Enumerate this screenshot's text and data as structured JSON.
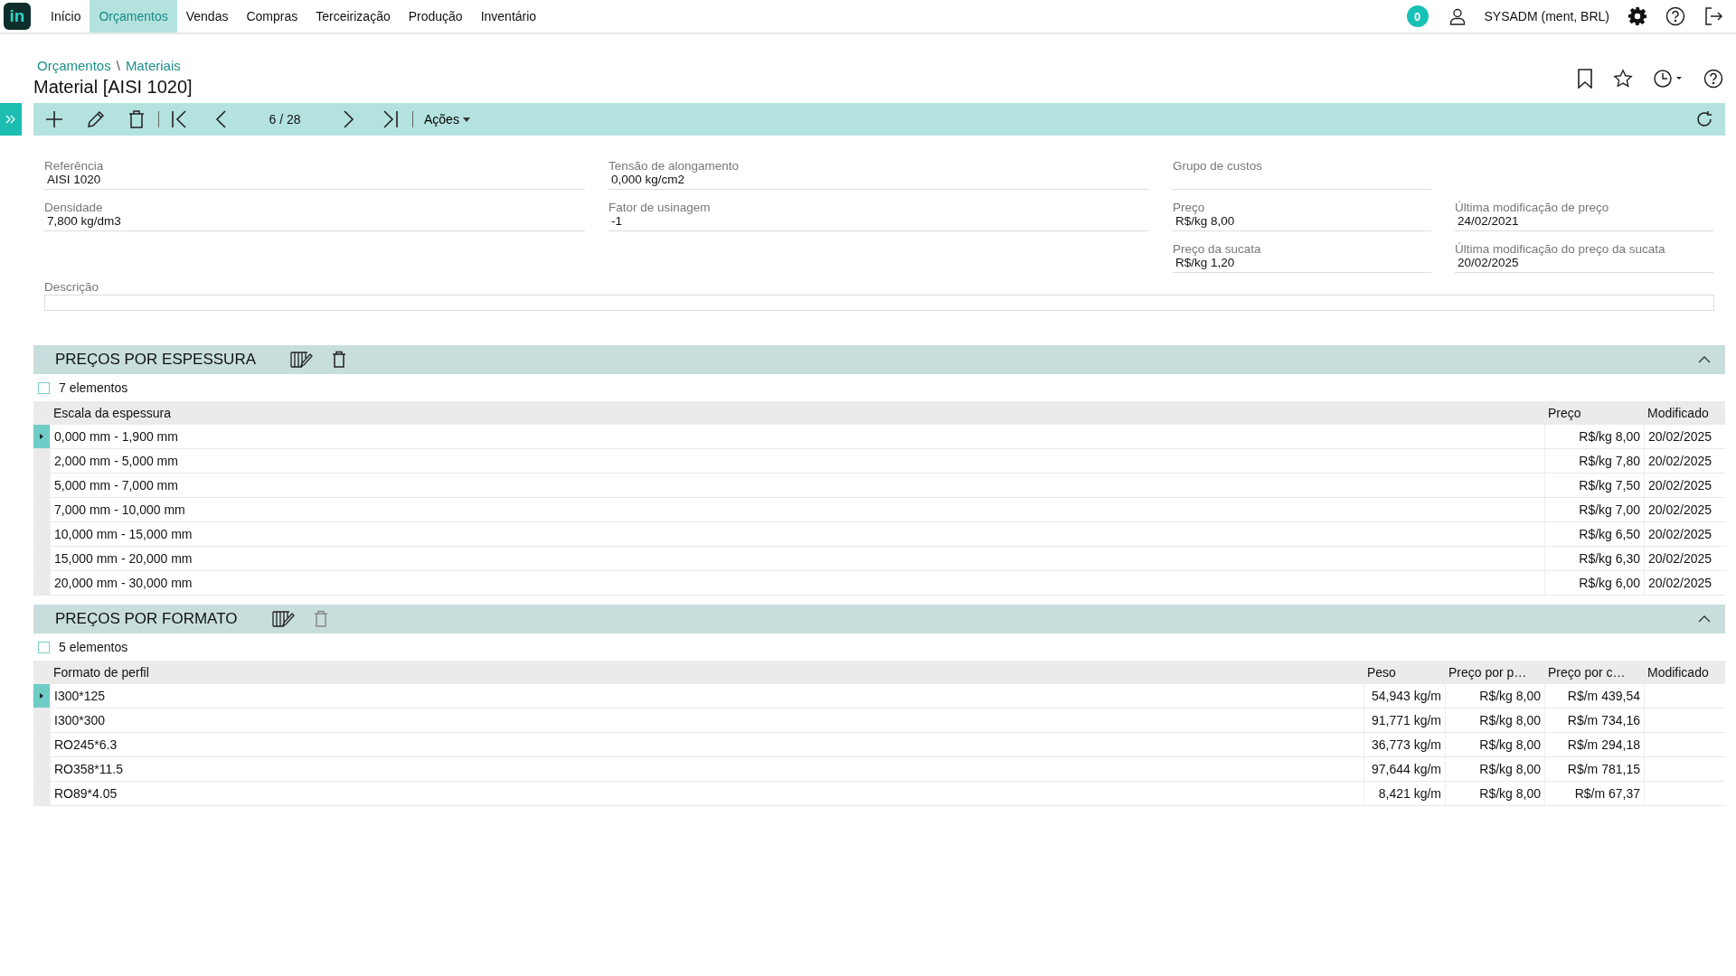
{
  "app_logo": "in",
  "nav": [
    {
      "label": "Início",
      "selected": false
    },
    {
      "label": "Orçamentos",
      "selected": true
    },
    {
      "label": "Vendas",
      "selected": false
    },
    {
      "label": "Compras",
      "selected": false
    },
    {
      "label": "Terceirização",
      "selected": false
    },
    {
      "label": "Produção",
      "selected": false
    },
    {
      "label": "Inventário",
      "selected": false
    }
  ],
  "notification_count": "0",
  "user": "SYSADM (ment, BRL)",
  "breadcrumb": [
    "Orçamentos",
    "Materiais"
  ],
  "breadcrumb_separator": "\\",
  "title": "Material [AISI 1020]",
  "toolbar": {
    "position": "6 / 28",
    "actions": "Ações"
  },
  "fields": [
    {
      "label": "Referência",
      "value": "AISI 1020"
    },
    {
      "label": "Tensão de alongamento",
      "value": "0,000 kg/cm2"
    },
    {
      "label": "Grupo de custos"
    },
    {
      "label": "Densidade",
      "value": "7,800 kg/dm3"
    },
    {
      "label": "Fator de usinagem",
      "value": "-1"
    },
    {
      "label": "Preço",
      "value": "R$/kg 8,00"
    },
    {
      "label": "Última modificação de preço",
      "value": "24/02/2021"
    },
    {
      "label": "Preço da sucata",
      "value": "R$/kg 1,20"
    },
    {
      "label": "Última modificação do preço da sucata",
      "value": "20/02/2025"
    }
  ],
  "description": {
    "label": "Descrição"
  },
  "sections": [
    {
      "title": "PREÇOS POR ESPESSURA",
      "expanded": true,
      "delete_disabled": false,
      "count": "7 elementos",
      "all_checked": false,
      "columns": [
        "Escala da espessura",
        "Preço",
        "Modificado"
      ],
      "rows": [
        {
          "selected": true,
          "cells": [
            "0,000 mm - 1,900 mm",
            "R$/kg 8,00",
            "20/02/2025"
          ]
        },
        {
          "selected": false,
          "cells": [
            "2,000 mm - 5,000 mm",
            "R$/kg 7,80",
            "20/02/2025"
          ]
        },
        {
          "selected": false,
          "cells": [
            "5,000 mm - 7,000 mm",
            "R$/kg 7,50",
            "20/02/2025"
          ]
        },
        {
          "selected": false,
          "cells": [
            "7,000 mm - 10,000 mm",
            "R$/kg 7,00",
            "20/02/2025"
          ]
        },
        {
          "selected": false,
          "cells": [
            "10,000 mm - 15,000 mm",
            "R$/kg 6,50",
            "20/02/2025"
          ]
        },
        {
          "selected": false,
          "cells": [
            "15,000 mm - 20,000 mm",
            "R$/kg 6,30",
            "20/02/2025"
          ]
        },
        {
          "selected": false,
          "cells": [
            "20,000 mm - 30,000 mm",
            "R$/kg 6,00",
            "20/02/2025"
          ]
        }
      ]
    },
    {
      "title": "PREÇOS POR FORMATO",
      "expanded": true,
      "delete_disabled": true,
      "count": "5 elementos",
      "all_checked": false,
      "columns": [
        "Formato de perfil",
        "Peso",
        "Preço por p…",
        "Preço por c…",
        "Modificado"
      ],
      "rows": [
        {
          "selected": true,
          "cells": [
            "I300*125",
            "54,943 kg/m",
            "R$/kg 8,00",
            "R$/m 439,54",
            ""
          ]
        },
        {
          "selected": false,
          "cells": [
            "I300*300",
            "91,771 kg/m",
            "R$/kg 8,00",
            "R$/m 734,16",
            ""
          ]
        },
        {
          "selected": false,
          "cells": [
            "RO245*6.3",
            "36,773 kg/m",
            "R$/kg 8,00",
            "R$/m 294,18",
            ""
          ]
        },
        {
          "selected": false,
          "cells": [
            "RO358*11.5",
            "97,644 kg/m",
            "R$/kg 8,00",
            "R$/m 781,15",
            ""
          ]
        },
        {
          "selected": false,
          "cells": [
            "RO89*4.05",
            "8,421 kg/m",
            "R$/kg 8,00",
            "R$/m 67,37",
            ""
          ]
        }
      ]
    }
  ]
}
